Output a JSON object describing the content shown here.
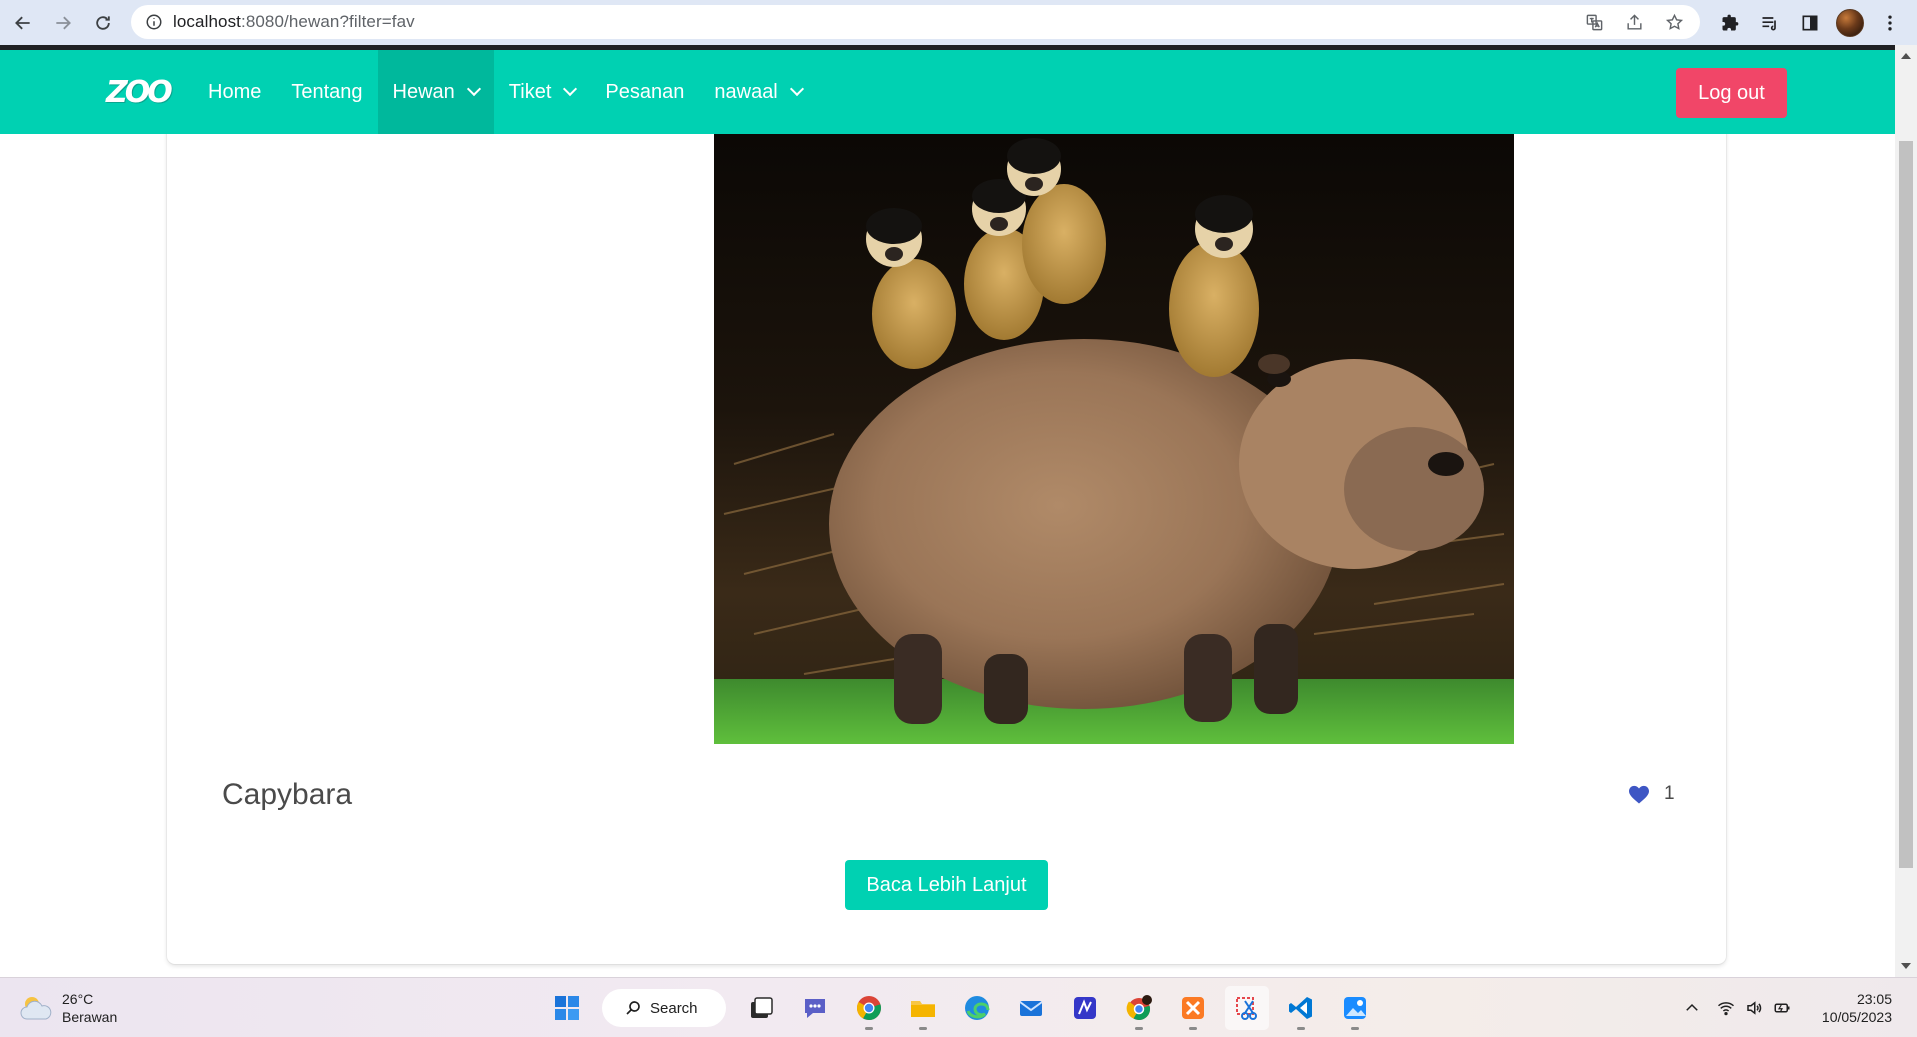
{
  "browser": {
    "url_host": "localhost",
    "url_rest": ":8080/hewan?filter=fav"
  },
  "navbar": {
    "logo_text": "ZOO",
    "items": [
      {
        "label": "Home"
      },
      {
        "label": "Tentang"
      },
      {
        "label": "Hewan"
      },
      {
        "label": "Tiket"
      },
      {
        "label": "Pesanan"
      },
      {
        "label": "nawaal"
      }
    ],
    "logout_label": "Log out",
    "brand_color": "#00d1b2",
    "active_color": "#00b89c",
    "danger_color": "#f14668"
  },
  "animal": {
    "name": "Capybara",
    "like_count": "1",
    "read_more_label": "Baca Lebih Lanjut"
  },
  "taskbar": {
    "weather_temp": "26°C",
    "weather_desc": "Berawan",
    "search_label": "Search",
    "time": "23:05",
    "date": "10/05/2023"
  }
}
